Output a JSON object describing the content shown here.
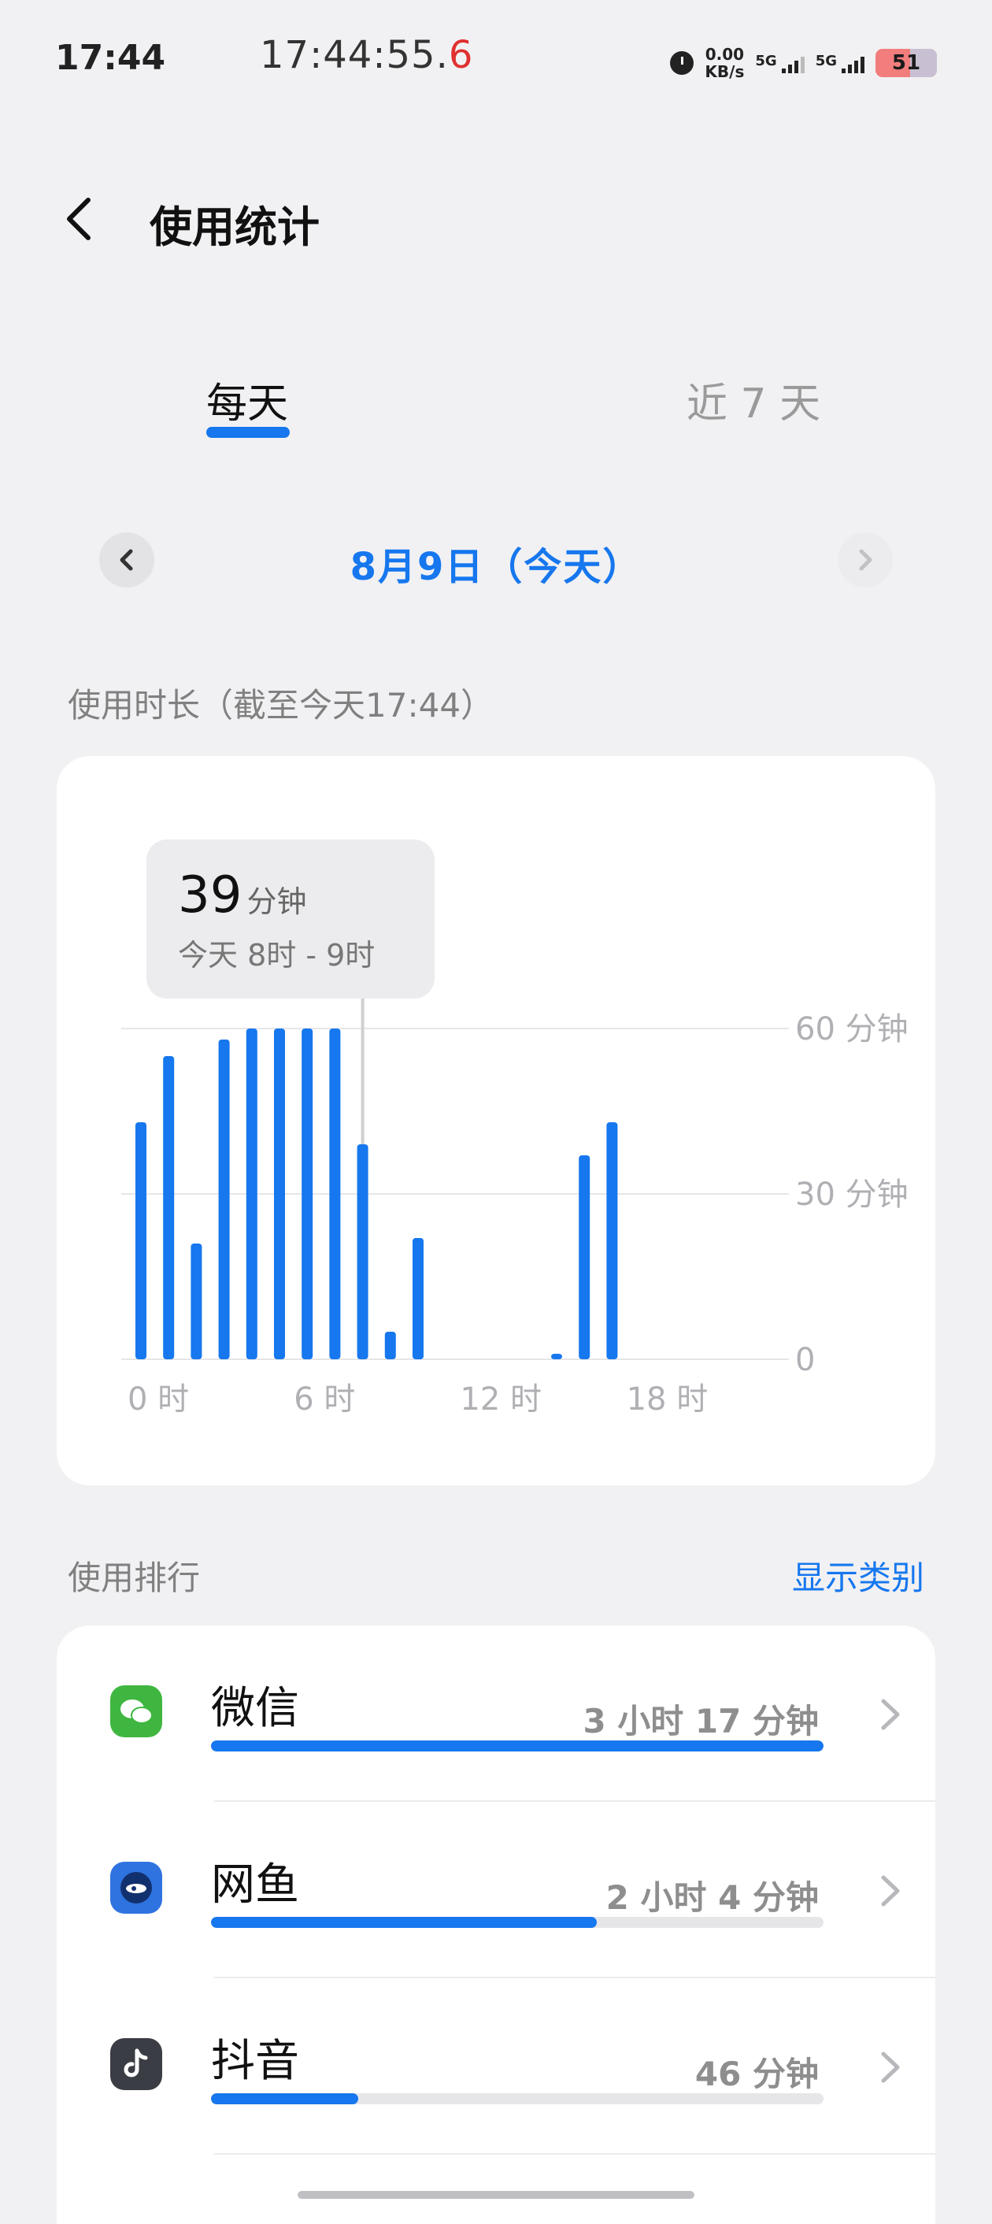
{
  "status_bar": {
    "time": "17:44",
    "clock": "17:44:55.",
    "clock_tail": "6",
    "net_speed_value": "0.00",
    "net_speed_unit": "KB/s",
    "sim1": "5G",
    "sim2": "5G",
    "battery": "51"
  },
  "header": {
    "title": "使用统计"
  },
  "tabs": [
    {
      "label": "每天",
      "selected": true
    },
    {
      "label": "近 7 天",
      "selected": false
    }
  ],
  "date_nav": {
    "label": "8月9日（今天）"
  },
  "usage_section": {
    "label": "使用时长（截至今天17:44）"
  },
  "chart_data": {
    "type": "bar",
    "ylim": [
      0,
      60
    ],
    "y_ticks": [
      "60 分钟",
      "30 分钟",
      "0"
    ],
    "y_tick_values": [
      60,
      30,
      0
    ],
    "x_ticks": [
      "0 时",
      "6 时",
      "12 时",
      "18 时"
    ],
    "x_tick_hours": [
      0,
      6,
      12,
      18
    ],
    "x": [
      0,
      1,
      2,
      3,
      4,
      5,
      6,
      7,
      8,
      9,
      10,
      11,
      12,
      13,
      14,
      15,
      16,
      17,
      18,
      19,
      20,
      21,
      22,
      23
    ],
    "values": [
      43,
      55,
      21,
      58,
      60,
      60,
      60,
      60,
      39,
      5,
      22,
      0,
      0,
      0,
      0,
      1,
      37,
      43,
      0,
      0,
      0,
      0,
      0,
      0
    ],
    "selected_index": 8,
    "tooltip": {
      "value": "39",
      "unit": "分钟",
      "range": "今天 8时 - 9时"
    },
    "color": "#1677ee"
  },
  "ranking": {
    "label": "使用排行",
    "show_category": "显示类别",
    "apps": [
      {
        "name": "微信",
        "duration": "3 小时 17 分钟",
        "progress": 1.0,
        "icon": "wechat-icon",
        "icon_color": "#3fb63f"
      },
      {
        "name": "网鱼",
        "duration": "2 小时 4 分钟",
        "progress": 0.63,
        "icon": "wangyu-icon",
        "icon_color": "#2f73e0"
      },
      {
        "name": "抖音",
        "duration": "46 分钟",
        "progress": 0.24,
        "icon": "douyin-icon",
        "icon_color": "#3b3d44"
      }
    ]
  },
  "colors": {
    "accent": "#1677ee",
    "background": "#f1f1f3"
  }
}
